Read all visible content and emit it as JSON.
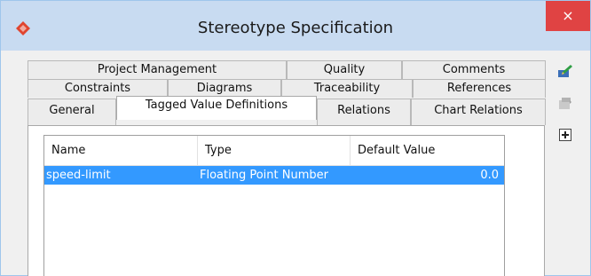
{
  "window": {
    "title": "Stereotype Specification",
    "close_glyph": "×"
  },
  "tabs": {
    "row1": [
      "Project Management",
      "Quality",
      "Comments"
    ],
    "row2": [
      "Constraints",
      "Diagrams",
      "Traceability",
      "References"
    ],
    "row3": [
      "General",
      "Tagged Value Definitions",
      "Relations",
      "Chart Relations"
    ],
    "selected": "Tagged Value Definitions"
  },
  "table": {
    "columns": [
      "Name",
      "Type",
      "Default Value"
    ],
    "rows": [
      {
        "name": "speed-limit",
        "type": "Floating Point Number",
        "default_value": "0.0"
      }
    ]
  },
  "side_buttons": [
    {
      "icon": "edit-icon"
    },
    {
      "icon": "remove-icon"
    },
    {
      "icon": "add-icon"
    }
  ],
  "colors": {
    "selection": "#3399ff",
    "title_bar": "#c8dbf1",
    "close": "#e04343"
  }
}
